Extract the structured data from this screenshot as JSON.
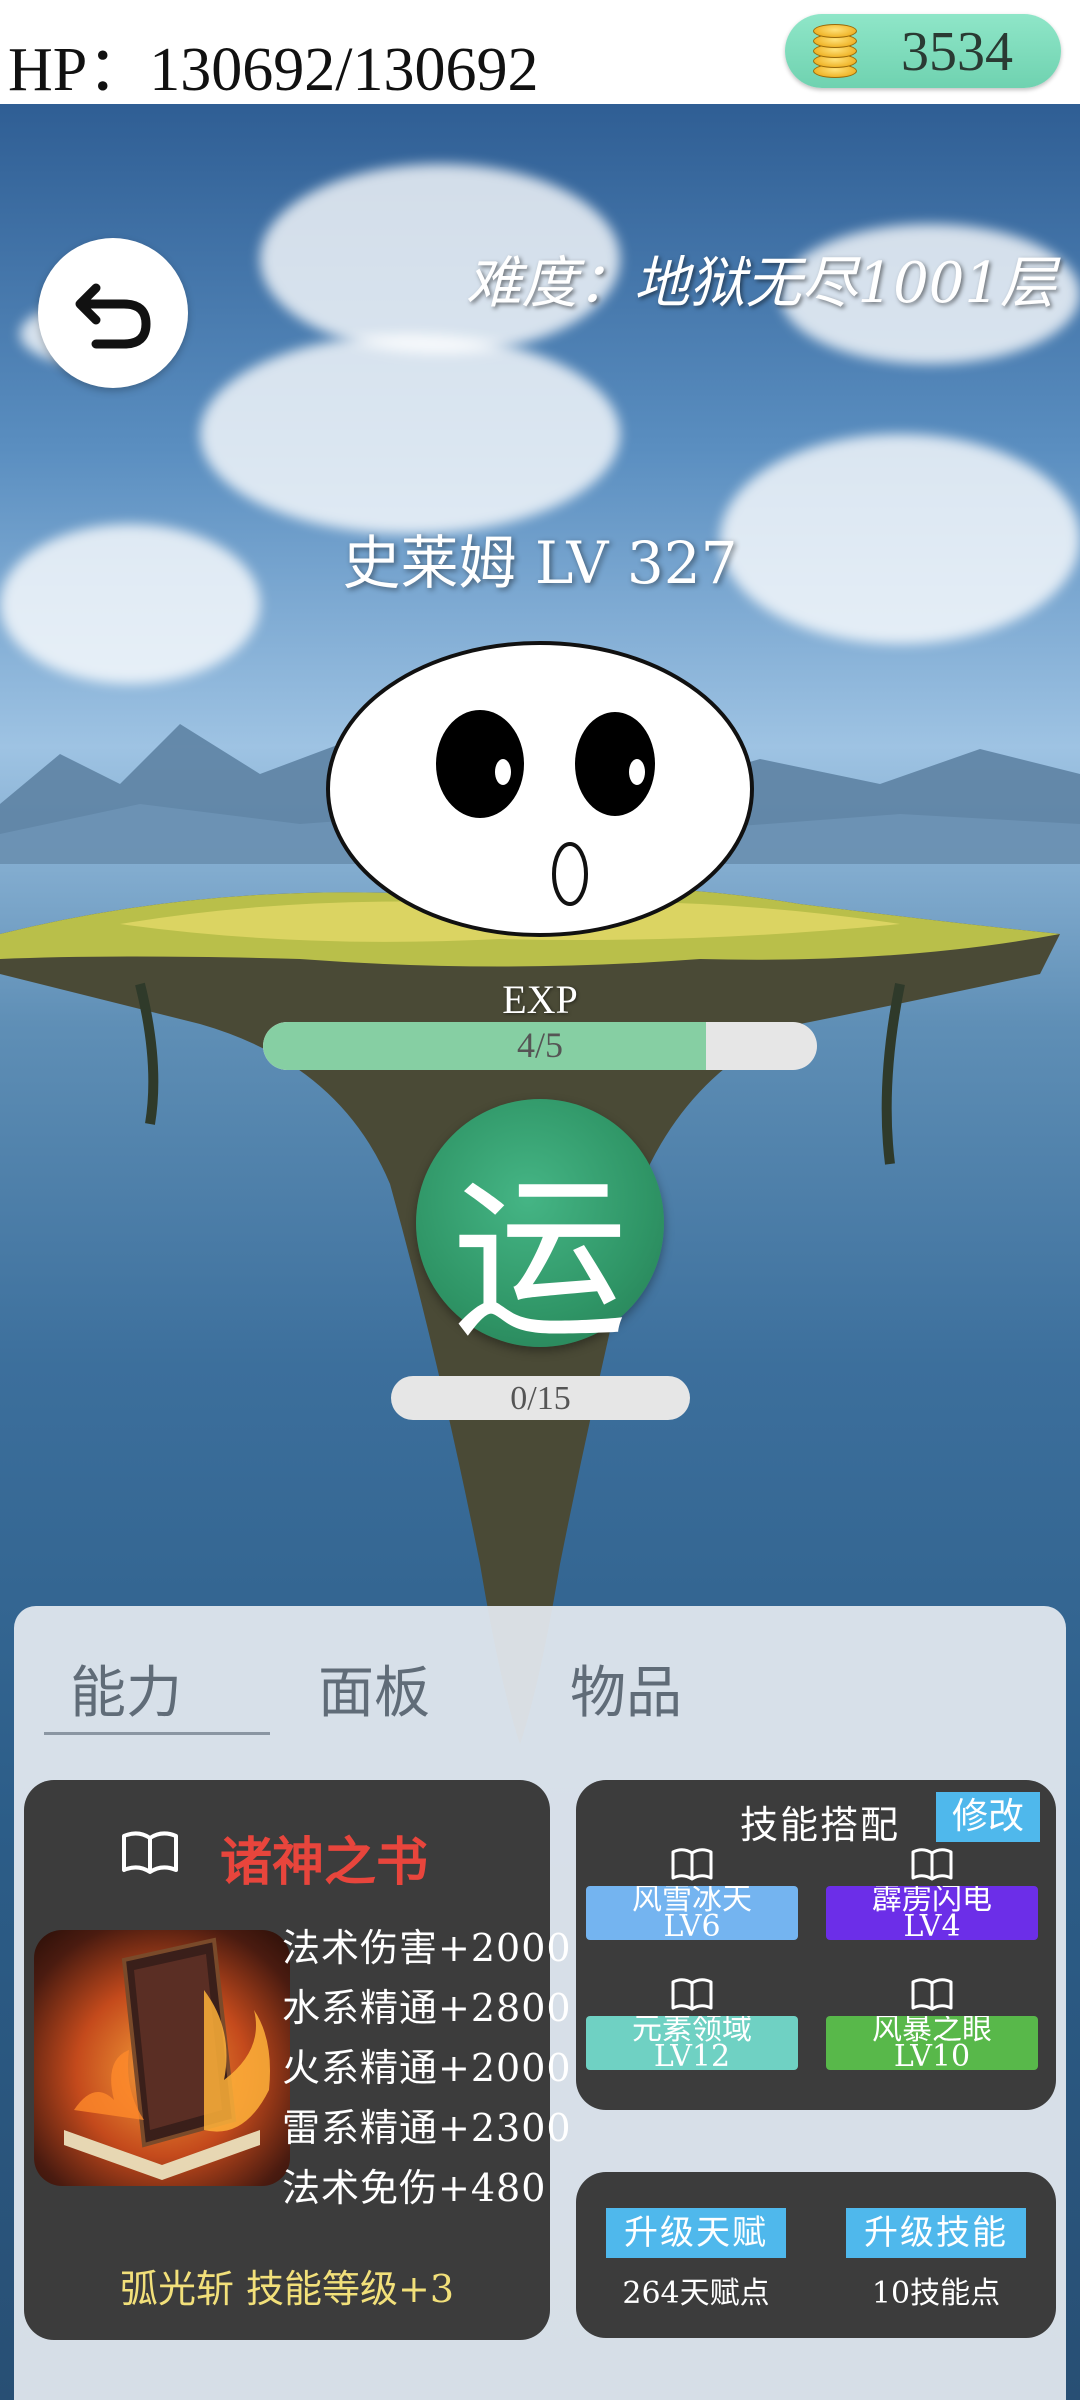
{
  "header": {
    "hp_text": "HP：130692/130692",
    "coins": "3534"
  },
  "scene": {
    "difficulty": "难度：地狱无尽1001层",
    "enemy_name": "史莱姆 LV 327",
    "exp_label": "EXP",
    "exp_text": "4/5",
    "exp_fraction": 0.8,
    "action_char": "运",
    "qi_text": "0/15"
  },
  "tabs": [
    {
      "label": "能力",
      "active": true
    },
    {
      "label": "面板",
      "active": false
    },
    {
      "label": "物品",
      "active": false
    }
  ],
  "book": {
    "name": "诸神之书",
    "stats": [
      "法术伤害+2000",
      "水系精通+2800",
      "火系精通+2000",
      "雷系精通+2300",
      "法术免伤+480"
    ],
    "bonus": "弧光斩 技能等级+3"
  },
  "skills": {
    "title": "技能搭配",
    "edit_label": "修改",
    "slots": [
      {
        "name": "风雪冰天",
        "level": "LV6",
        "color": "#74b4f0"
      },
      {
        "name": "霹雳闪电",
        "level": "LV4",
        "color": "#6c2ee8"
      },
      {
        "name": "元素领域",
        "level": "LV12",
        "color": "#6fd1c3"
      },
      {
        "name": "风暴之眼",
        "level": "LV10",
        "color": "#58b84a"
      }
    ]
  },
  "upgrade": {
    "talent_label": "升级天赋",
    "talent_points": "264天赋点",
    "skill_label": "升级技能",
    "skill_points": "10技能点"
  },
  "icons": {
    "back": "back-arrow-icon",
    "coin": "coin-stack-icon",
    "book": "open-book-icon"
  },
  "colors": {
    "accent_blue": "#4fb8ec",
    "action_green": "#2f9566",
    "book_title_red": "#e8453c",
    "bonus_yellow": "#f2e07a"
  }
}
